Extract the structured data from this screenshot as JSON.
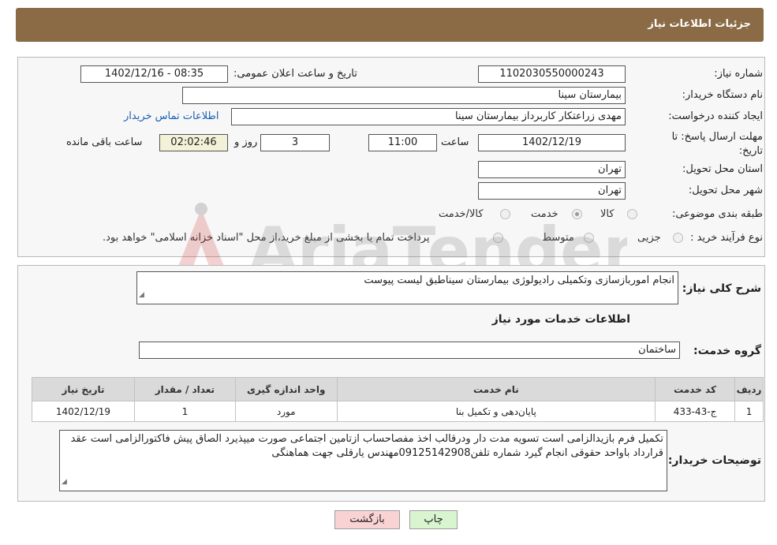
{
  "header": {
    "title": "جزئیات اطلاعات نیاز"
  },
  "form": {
    "need_number": {
      "label": "شماره نیاز:",
      "value": "1102030550000243"
    },
    "announce_datetime": {
      "label": "تاریخ و ساعت اعلان عمومی:",
      "value": "1402/12/16 - 08:35"
    },
    "buyer_org": {
      "label": "نام دستگاه خریدار:",
      "value": "بیمارستان سینا"
    },
    "requester": {
      "label": "ایجاد کننده درخواست:",
      "value": "مهدی  زراعتکار  کاربرداز بیمارستان سینا"
    },
    "buyer_contact_link": "اطلاعات تماس خریدار",
    "deadline": {
      "label": "مهلت ارسال پاسخ: تا تاریخ:",
      "date": "1402/12/19",
      "time_label": "ساعت",
      "time": "11:00",
      "days": "3",
      "days_label": "روز و",
      "remaining": "02:02:46",
      "remaining_label": "ساعت باقی مانده"
    },
    "province": {
      "label": "استان محل تحویل:",
      "value": "تهران"
    },
    "city": {
      "label": "شهر محل تحویل:",
      "value": "تهران"
    },
    "category": {
      "label": "طبقه بندی موضوعی:",
      "options": [
        "کالا",
        "خدمت",
        "کالا/خدمت"
      ],
      "selected": "خدمت"
    },
    "purchase_process": {
      "label": "نوع فرآیند خرید :",
      "options": [
        "جزیی",
        "متوسط"
      ],
      "note": "پرداخت تمام یا بخشی از مبلغ خرید،از محل \"اسناد خزانه اسلامی\" خواهد بود."
    }
  },
  "details": {
    "summary_label": "شرح کلی نیاز:",
    "summary_value": "انجام  اموربازسازی وتکمیلی رادیولوژی بیمارستان سیناطبق لیست پیوست",
    "services_title": "اطلاعات خدمات مورد نیاز",
    "service_group_label": "گروه خدمت:",
    "service_group_value": "ساختمان",
    "table": {
      "headers": [
        "ردیف",
        "کد خدمت",
        "نام خدمت",
        "واحد اندازه گیری",
        "تعداد / مقدار",
        "تاریخ نیاز"
      ],
      "rows": [
        [
          "1",
          "ج-43-433",
          "پایان‌دهی و تکمیل بنا",
          "مورد",
          "1",
          "1402/12/19"
        ]
      ]
    },
    "buyer_notes_label": "توضیحات خریدار:",
    "buyer_notes_value": "تکمیل فرم بازیدالزامی است تسویه مدت دار ودرقالب اخذ مفصاحساب ازتامین اجتماعی صورت میپذیرد الصاق پیش فاکتورالزامی است عقد قرارداد باواحد حقوقی انجام گیرد شماره تلفن09125142908مهندس یارقلی جهت هماهنگی"
  },
  "buttons": {
    "print": "چاپ",
    "back": "بازگشت"
  },
  "watermark": "AriaTender.net",
  "colors": {
    "header_bg": "#8b6b46",
    "link": "#1a5fb4",
    "back_btn": "#f9d3d3",
    "print_btn": "#d9f5d0"
  }
}
